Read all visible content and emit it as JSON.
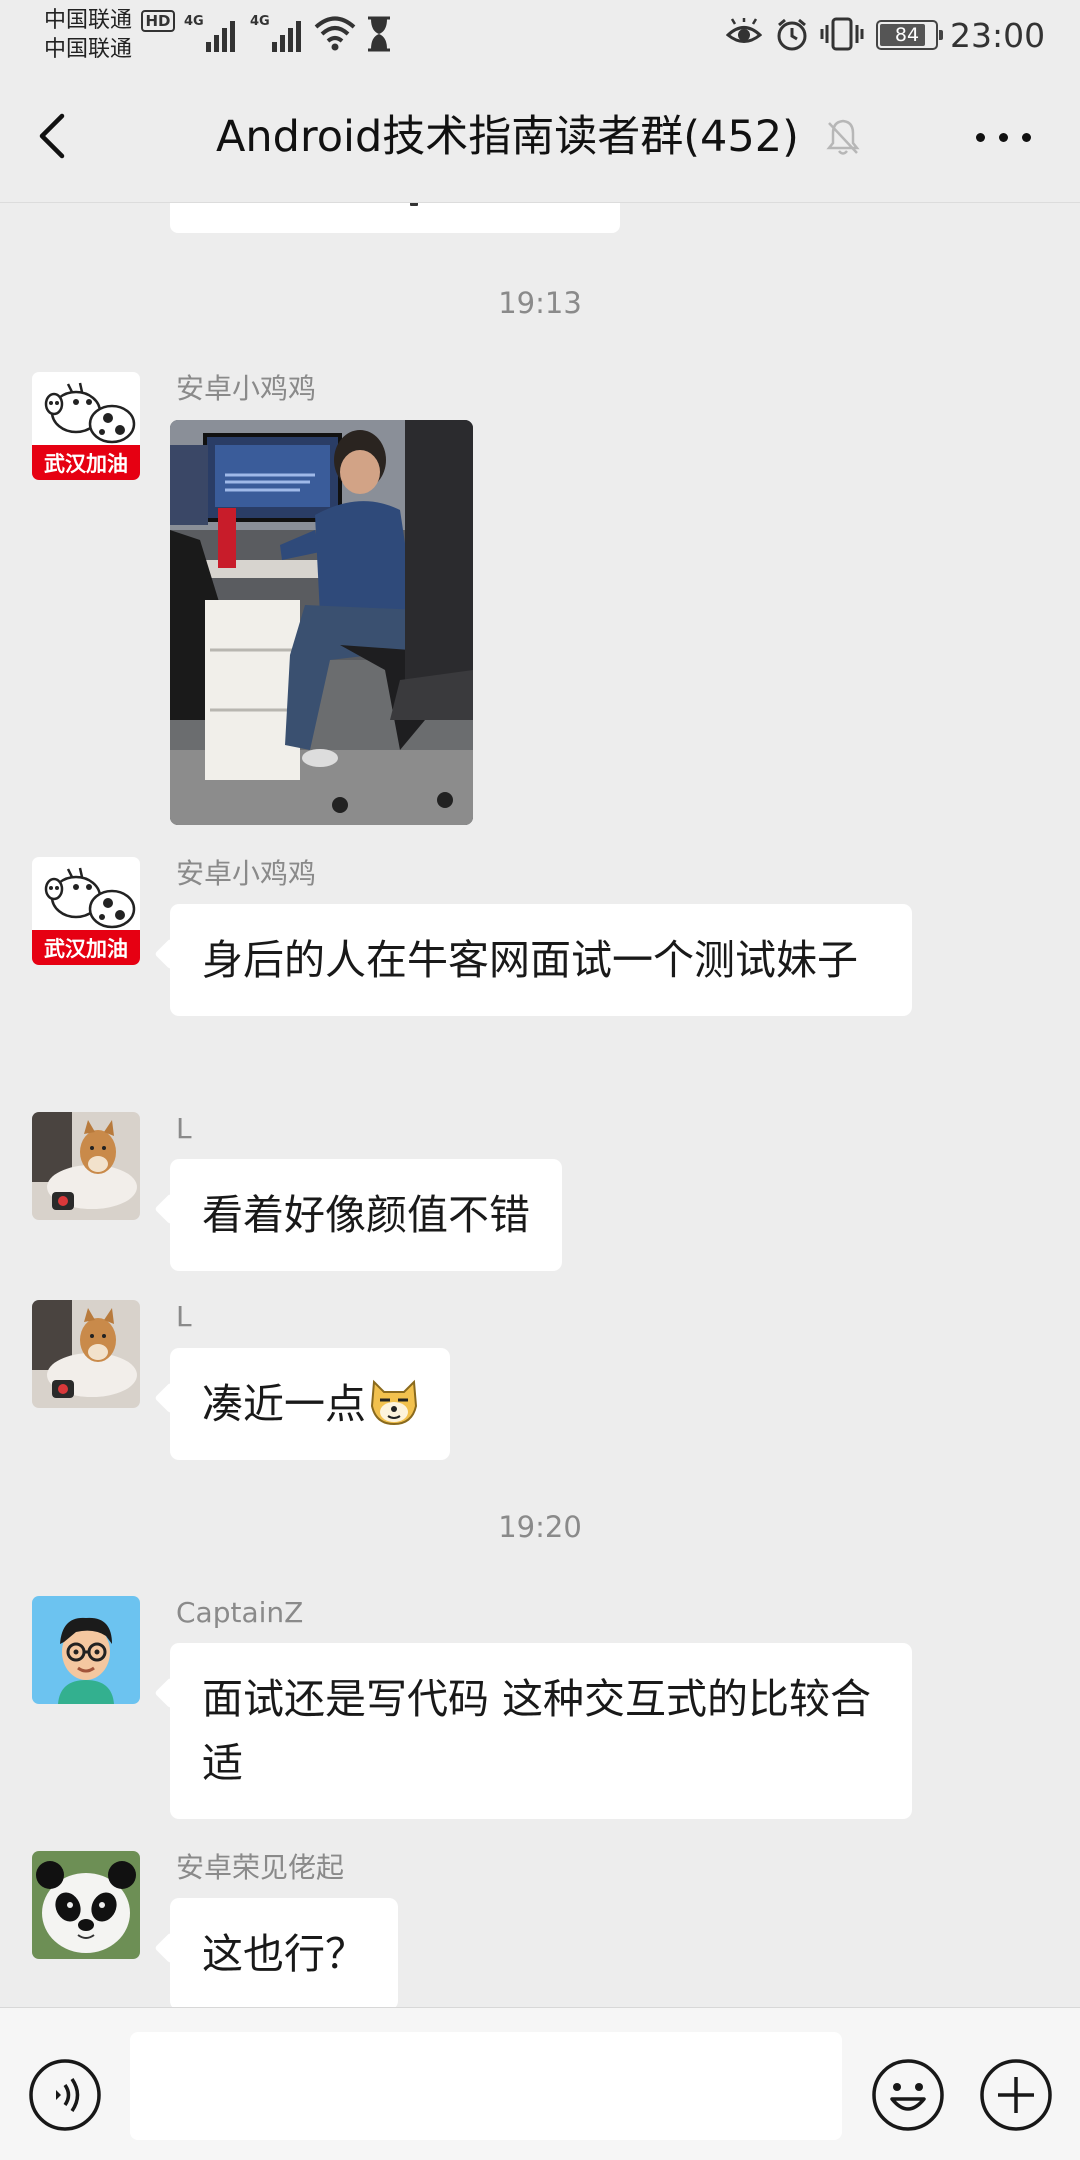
{
  "status_bar": {
    "carrier_1": "中国联通",
    "carrier_2": "中国联通",
    "hd_badge": "HD",
    "network_1": "4G",
    "network_2": "4G",
    "battery_level": "84",
    "battery_fraction": 0.84,
    "time": "23:00",
    "icons": [
      "signal-icon",
      "wifi-icon",
      "hourglass-icon",
      "eye-icon",
      "alarm-icon",
      "vibrate-icon",
      "battery-icon"
    ]
  },
  "header": {
    "title": "Android技术指南读者群(452)",
    "back_icon": "chevron-left-icon",
    "mute_icon": "bell-off-icon",
    "more_icon": "more-icon"
  },
  "chat": {
    "timestamps": [
      "19:13",
      "19:20"
    ],
    "messages": [
      {
        "sender": "安卓小鸡鸡",
        "type": "image",
        "avatar": "peppa-pig-avatar",
        "avatar_badge": "武汉加油"
      },
      {
        "sender": "安卓小鸡鸡",
        "type": "text",
        "text": "身后的人在牛客网面试一个测试妹子",
        "avatar": "peppa-pig-avatar",
        "avatar_badge": "武汉加油"
      },
      {
        "sender": "L",
        "type": "text",
        "text": "看着好像颜值不错",
        "avatar": "shiba-dog-avatar"
      },
      {
        "sender": "L",
        "type": "text",
        "text": "凑近一点",
        "emoji": "doge-emoji",
        "avatar": "shiba-dog-avatar"
      },
      {
        "sender": "CaptainZ",
        "type": "text",
        "text": "面试还是写代码 这种交互式的比较合适",
        "avatar": "cartoon-man-avatar"
      },
      {
        "sender": "安卓荣见佬起",
        "type": "text",
        "text": "这也行？",
        "avatar": "panda-avatar"
      }
    ]
  },
  "input_bar": {
    "text_value": "",
    "voice_icon": "voice-icon",
    "emoji_icon": "emoji-icon",
    "plus_icon": "plus-icon"
  },
  "colors": {
    "background": "#ededed",
    "bubble": "#ffffff",
    "badge_red": "#e60012",
    "avatar_blue": "#6cc3f0"
  }
}
